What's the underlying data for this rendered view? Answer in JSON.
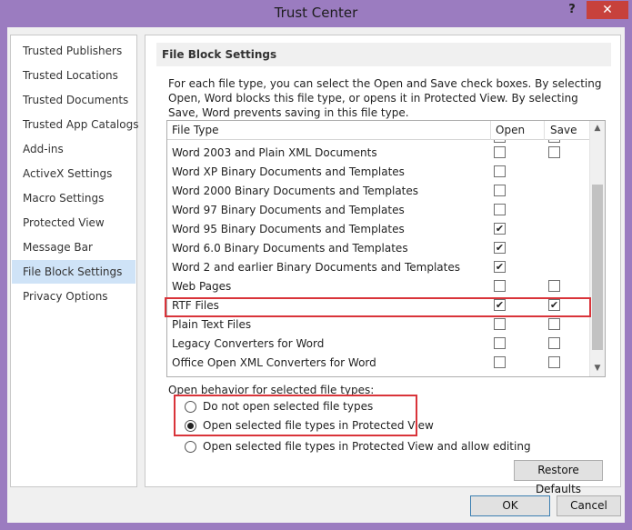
{
  "window": {
    "title": "Trust Center",
    "help_glyph": "?",
    "close_glyph": "✕"
  },
  "nav": {
    "items": [
      {
        "label": "Trusted Publishers",
        "selected": false
      },
      {
        "label": "Trusted Locations",
        "selected": false
      },
      {
        "label": "Trusted Documents",
        "selected": false
      },
      {
        "label": "Trusted App Catalogs",
        "selected": false
      },
      {
        "label": "Add-ins",
        "selected": false
      },
      {
        "label": "ActiveX Settings",
        "selected": false
      },
      {
        "label": "Macro Settings",
        "selected": false
      },
      {
        "label": "Protected View",
        "selected": false
      },
      {
        "label": "Message Bar",
        "selected": false
      },
      {
        "label": "File Block Settings",
        "selected": true
      },
      {
        "label": "Privacy Options",
        "selected": false
      }
    ]
  },
  "panel": {
    "section_title": "File Block Settings",
    "description": "For each file type, you can select the Open and Save check boxes. By selecting Open, Word blocks this file type, or opens it in Protected View. By selecting Save, Word prevents saving in this file type.",
    "table": {
      "headers": {
        "file_type": "File Type",
        "open": "Open",
        "save": "Save"
      },
      "rows": [
        {
          "label": "Word 2003 and Plain XML Documents",
          "open": false,
          "save": false,
          "has_save": true
        },
        {
          "label": "Word XP Binary Documents and Templates",
          "open": false,
          "save": false,
          "has_save": false
        },
        {
          "label": "Word 2000 Binary Documents and Templates",
          "open": false,
          "save": false,
          "has_save": false
        },
        {
          "label": "Word 97 Binary Documents and Templates",
          "open": false,
          "save": false,
          "has_save": false
        },
        {
          "label": "Word 95 Binary Documents and Templates",
          "open": true,
          "save": false,
          "has_save": false
        },
        {
          "label": "Word 6.0 Binary Documents and Templates",
          "open": true,
          "save": false,
          "has_save": false
        },
        {
          "label": "Word 2 and earlier Binary Documents and Templates",
          "open": true,
          "save": false,
          "has_save": false
        },
        {
          "label": "Web Pages",
          "open": false,
          "save": false,
          "has_save": true
        },
        {
          "label": "RTF Files",
          "open": true,
          "save": true,
          "has_save": true
        },
        {
          "label": "Plain Text Files",
          "open": false,
          "save": false,
          "has_save": true
        },
        {
          "label": "Legacy Converters for Word",
          "open": false,
          "save": false,
          "has_save": true
        },
        {
          "label": "Office Open XML Converters for Word",
          "open": false,
          "save": false,
          "has_save": true
        }
      ],
      "highlighted_row": "RTF Files"
    },
    "open_behavior": {
      "label": "Open behavior for selected file types:",
      "options": [
        {
          "label": "Do not open selected file types",
          "selected": false
        },
        {
          "label": "Open selected file types in Protected View",
          "selected": true
        },
        {
          "label": "Open selected file types in Protected View and allow editing",
          "selected": false
        }
      ]
    },
    "restore_defaults_label": "Restore Defaults"
  },
  "footer": {
    "ok_label": "OK",
    "cancel_label": "Cancel"
  },
  "colors": {
    "titlebar": "#9b7cc0",
    "close_button": "#c7413c",
    "highlight_box": "#d9343a",
    "nav_selected": "#cfe3f7"
  }
}
